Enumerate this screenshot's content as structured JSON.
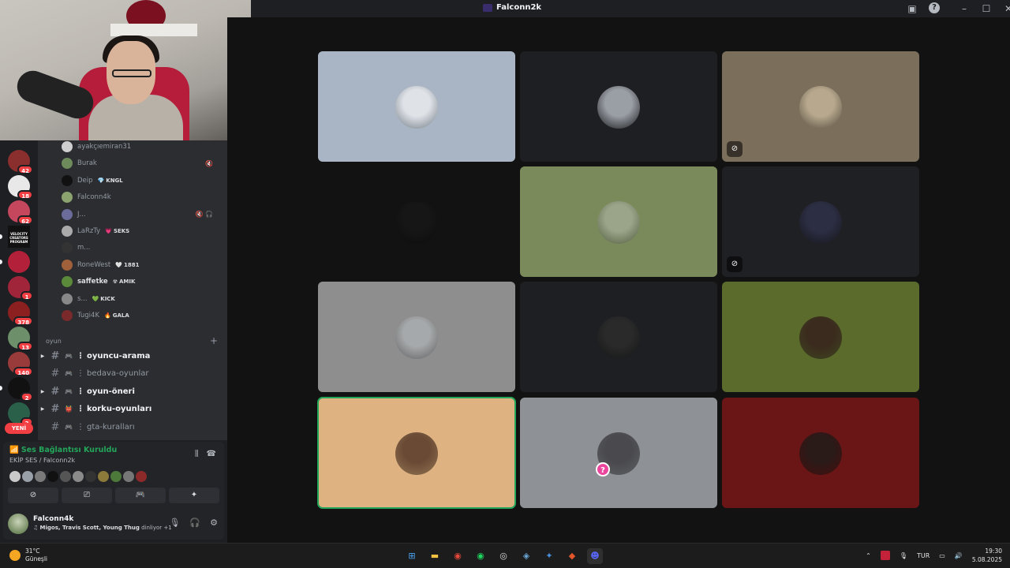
{
  "window": {
    "title": "Falconn2k",
    "help_icon": "?",
    "minimize": "–",
    "maximize": "☐",
    "close": "✕"
  },
  "rail": {
    "servers": [
      {
        "badge": "42",
        "color": "#8b2e2e"
      },
      {
        "badge": "18",
        "color": "#e8e8e8"
      },
      {
        "badge": "62",
        "color": "#c4475e"
      },
      {
        "badge": "",
        "color": "#111111",
        "label": "VELOCITY CREATORS PROGRAM"
      },
      {
        "badge": "",
        "color": "#b3203a"
      },
      {
        "badge": "1",
        "color": "#a0243a"
      },
      {
        "badge": "378",
        "color": "#8c2020"
      },
      {
        "badge": "13",
        "color": "#6d8f6a"
      },
      {
        "badge": "140",
        "color": "#9a3b3b"
      },
      {
        "badge": "2",
        "color": "#111111"
      },
      {
        "badge": "2",
        "color": "#2a5f4a"
      }
    ],
    "new_label": "YENİ"
  },
  "voice_users": [
    {
      "name": "ayakçıemiran31",
      "color": "#cfcfcf",
      "bright": false,
      "tag": "",
      "icons": ""
    },
    {
      "name": "Burak",
      "color": "#6e8b5c",
      "bright": false,
      "tag": "",
      "icons": "🔇"
    },
    {
      "name": "Deip",
      "color": "#111111",
      "bright": false,
      "tag": "KNGL",
      "tag_icon": "💎",
      "icons": ""
    },
    {
      "name": "Falconn4k",
      "color": "#8ba36f",
      "bright": false,
      "tag": "",
      "icons": ""
    },
    {
      "name": "J...",
      "color": "#6c6c9a",
      "bright": false,
      "tag": "",
      "icons": "🔇 🎧"
    },
    {
      "name": "LaRzTy",
      "color": "#aaaaaa",
      "bright": false,
      "tag": "SEKS",
      "tag_icon": "💗",
      "icons": ""
    },
    {
      "name": "m...",
      "color": "#333333",
      "bright": false,
      "tag": "",
      "icons": ""
    },
    {
      "name": "RoneWest",
      "color": "#a0603a",
      "bright": false,
      "tag": "1881",
      "tag_icon": "🤍",
      "icons": ""
    },
    {
      "name": "saffetke",
      "color": "#5a8a3a",
      "bright": true,
      "tag": "AMIK",
      "tag_icon": "☢",
      "icons": ""
    },
    {
      "name": "s...",
      "color": "#888888",
      "bright": false,
      "tag": "KICK",
      "tag_icon": "💚",
      "icons": ""
    },
    {
      "name": "Tugi4K",
      "color": "#7a2a2a",
      "bright": false,
      "tag": "GALA",
      "tag_icon": "🔥",
      "icons": ""
    }
  ],
  "category": {
    "name": "oyun",
    "add": "+"
  },
  "channels": [
    {
      "name": "oyuncu-arama",
      "emoji": "🎮",
      "unread": true
    },
    {
      "name": "bedava-oyunlar",
      "emoji": "🎮",
      "unread": false
    },
    {
      "name": "oyun-öneri",
      "emoji": "🎮",
      "unread": true
    },
    {
      "name": "korku-oyunları",
      "emoji": "👹",
      "unread": true
    },
    {
      "name": "gta-kuralları",
      "emoji": "🎮",
      "unread": false
    }
  ],
  "voice_panel": {
    "status": "Ses Bağlantısı Kuruldu",
    "channel": "EKİP SES / Falconn2k",
    "avatars": [
      "#c9c9c9",
      "#9aa0a8",
      "#7a7a7a",
      "#111111",
      "#555555",
      "#8a8a8a",
      "#333333",
      "#8c7a3a",
      "#4d7a3a",
      "#777777",
      "#8c2a2a"
    ]
  },
  "user": {
    "name": "Falconn4k",
    "activity": "Migos, Travis Scott, Young Thug",
    "activity_suffix": "dinliyor +1"
  },
  "tiles": [
    {
      "bg": "#a9b5c4",
      "av": "#dfe3e8",
      "mute": false,
      "speaking": false,
      "q": false
    },
    {
      "bg": "#1e1f22",
      "av": "#9a9ea5",
      "mute": false,
      "speaking": false,
      "q": false
    },
    {
      "bg": "#7b6e5b",
      "av": "#b8a98e",
      "mute": true,
      "speaking": false,
      "q": false
    },
    {
      "bg": "#121212",
      "av": "#161616",
      "mute": false,
      "speaking": false,
      "q": false
    },
    {
      "bg": "#7b8a5a",
      "av": "#9aa58a",
      "mute": false,
      "speaking": false,
      "q": false
    },
    {
      "bg": "#1f2024",
      "av": "#2c2e44",
      "mute": true,
      "speaking": false,
      "q": false
    },
    {
      "bg": "#8e8e8e",
      "av": "#a6a9ab",
      "mute": false,
      "speaking": false,
      "q": false
    },
    {
      "bg": "#1e1f22",
      "av": "#2a2a2a",
      "mute": false,
      "speaking": false,
      "q": false
    },
    {
      "bg": "#5b6b2c",
      "av": "#3b2a1e",
      "mute": false,
      "speaking": false,
      "q": false
    },
    {
      "bg": "#deb281",
      "av": "#6a4a34",
      "mute": false,
      "speaking": true,
      "q": false
    },
    {
      "bg": "#8e9196",
      "av": "#4a4a4e",
      "mute": false,
      "speaking": false,
      "q": true
    },
    {
      "bg": "#6a1616",
      "av": "#2a1a18",
      "mute": false,
      "speaking": false,
      "q": false
    }
  ],
  "taskbar": {
    "temp": "31°C",
    "weather": "Güneşli",
    "lang": "TUR",
    "time": "19:30",
    "date": "5.08.2025",
    "apps": [
      "windows-start",
      "file-explorer",
      "chrome",
      "spotify",
      "obs",
      "steam",
      "app-blue",
      "app-red",
      "discord"
    ]
  }
}
